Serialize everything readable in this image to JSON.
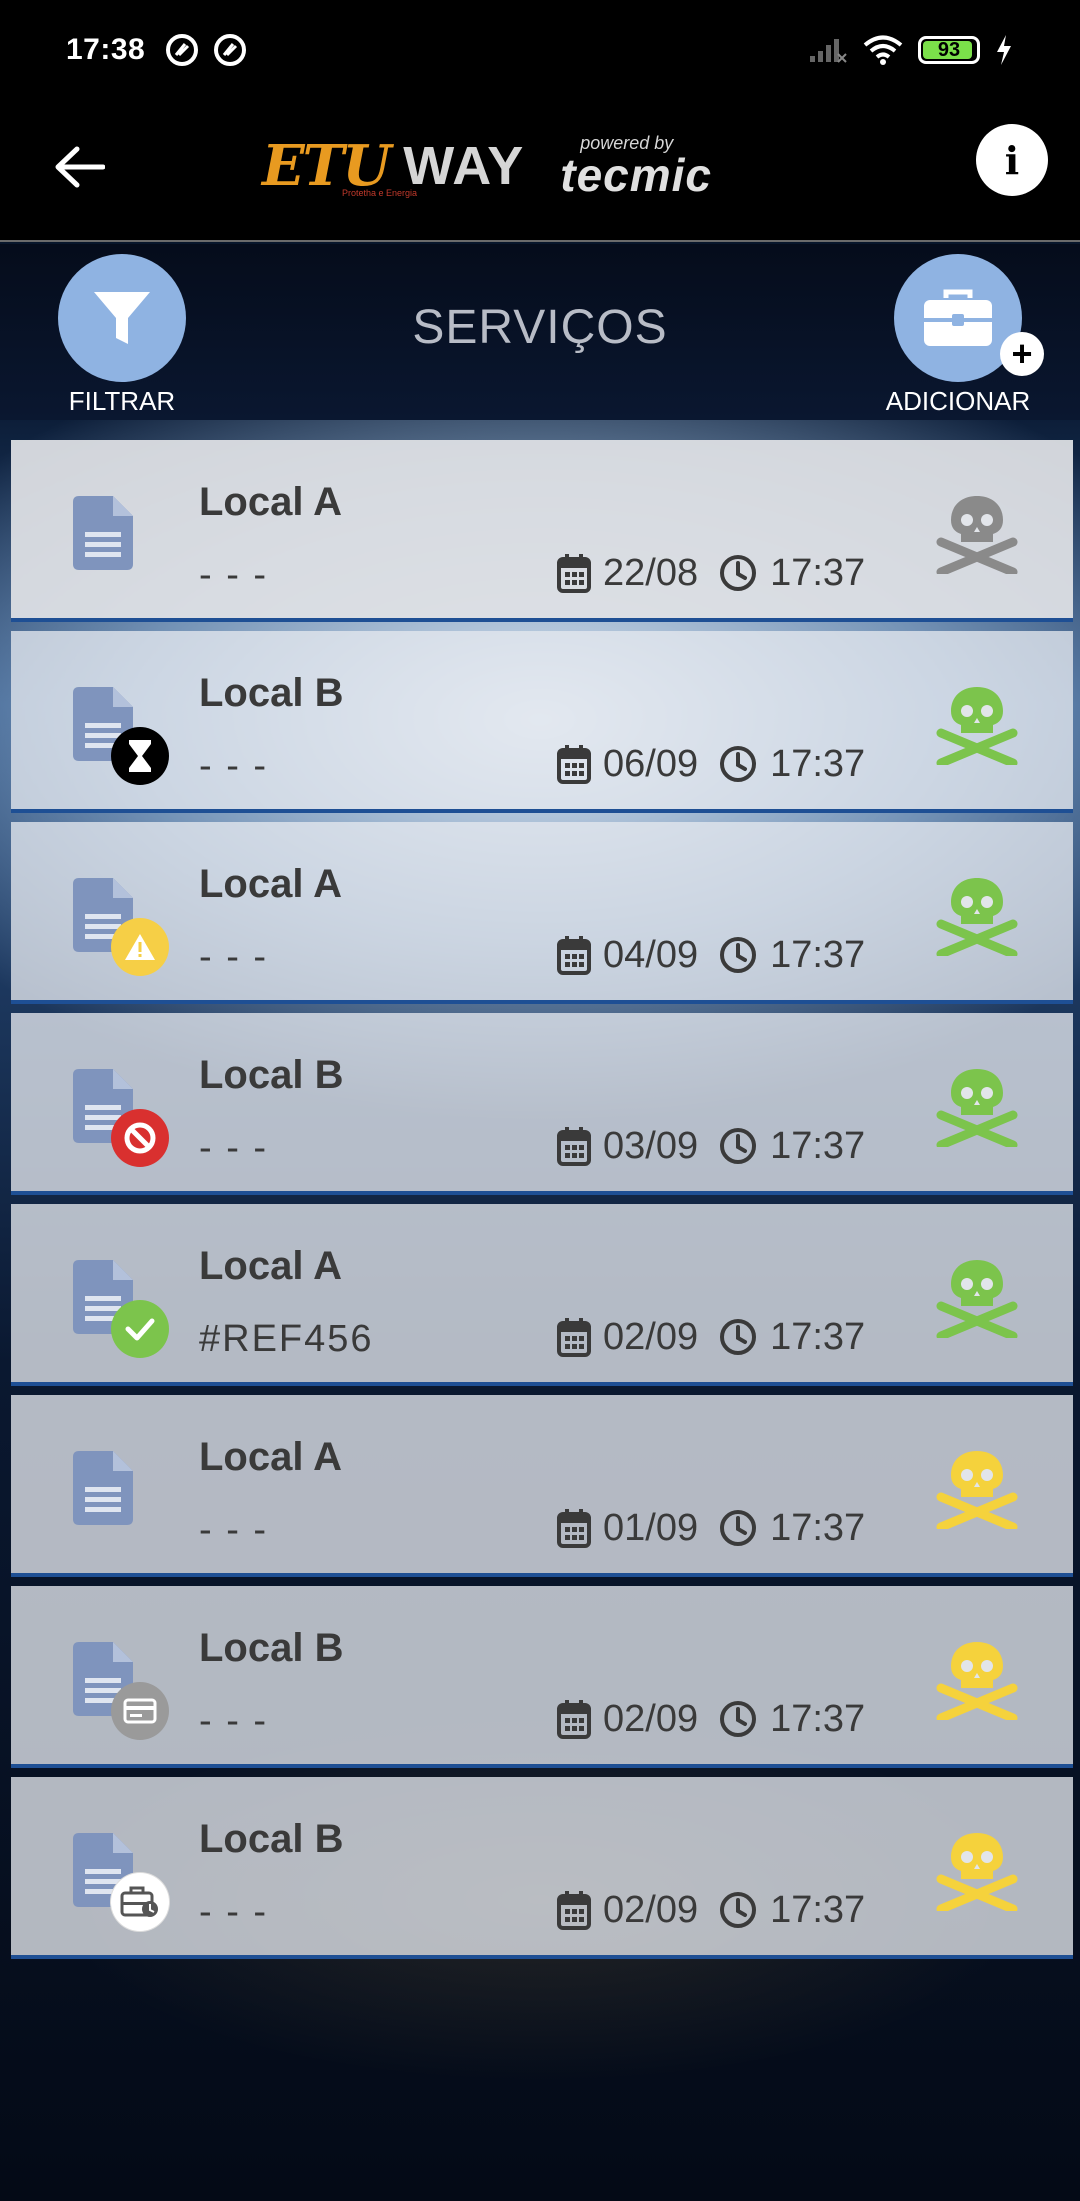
{
  "status_bar": {
    "time": "17:38",
    "battery": "93"
  },
  "header": {
    "logo_etu": "ETU",
    "logo_sub": "Protetha e Energia",
    "logo_way": "WAY",
    "logo_powered_by": "powered by",
    "logo_tecmic": "tecmic",
    "info_label": "i"
  },
  "toolbar": {
    "title": "SERVIÇOS",
    "filter_label": "FILTRAR",
    "add_label": "ADICIONAR",
    "add_plus": "+"
  },
  "colors": {
    "skull_gray": "#8a8a8a",
    "skull_green": "#7cc44c",
    "skull_yellow": "#f5d23c",
    "badge_black": "#000000",
    "badge_warning": "#f6cf46",
    "badge_blocked": "#d9302f",
    "badge_done": "#7cc44c",
    "badge_gray": "#9a9a9a",
    "badge_white": "#ffffff",
    "accent": "#8fb3e2"
  },
  "services": [
    {
      "title": "Local A",
      "ref": "- - -",
      "date": "22/08",
      "time": "17:37",
      "badge": "none",
      "skull": "gray"
    },
    {
      "title": "Local B",
      "ref": "- - -",
      "date": "06/09",
      "time": "17:37",
      "badge": "hourglass-icon",
      "skull": "green"
    },
    {
      "title": "Local A",
      "ref": "- - -",
      "date": "04/09",
      "time": "17:37",
      "badge": "warning-icon",
      "skull": "green"
    },
    {
      "title": "Local B",
      "ref": "- - -",
      "date": "03/09",
      "time": "17:37",
      "badge": "blocked-icon",
      "skull": "green"
    },
    {
      "title": "Local A",
      "ref": "#REF456",
      "date": "02/09",
      "time": "17:37",
      "badge": "check-icon",
      "skull": "green"
    },
    {
      "title": "Local A",
      "ref": "- - -",
      "date": "01/09",
      "time": "17:37",
      "badge": "none",
      "skull": "yellow"
    },
    {
      "title": "Local B",
      "ref": "- - -",
      "date": "02/09",
      "time": "17:37",
      "badge": "card-icon",
      "skull": "yellow"
    },
    {
      "title": "Local B",
      "ref": "- - -",
      "date": "02/09",
      "time": "17:37",
      "badge": "briefcase-clock-icon",
      "skull": "yellow"
    }
  ]
}
